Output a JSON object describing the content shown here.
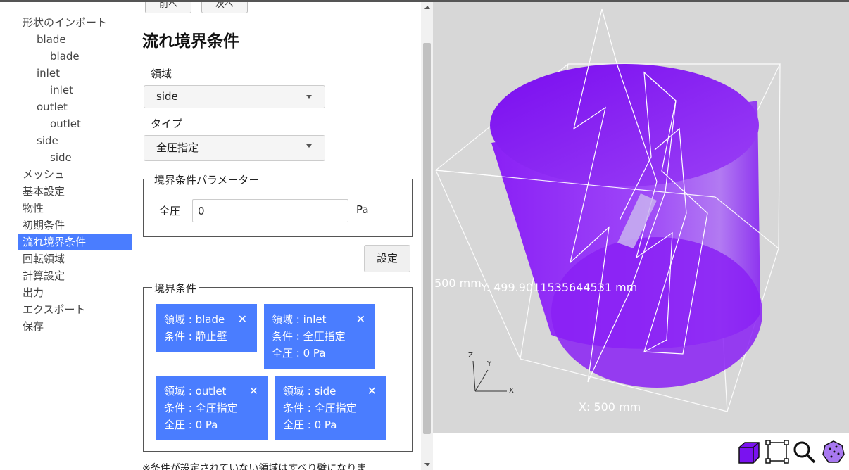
{
  "sidebar": {
    "items": [
      {
        "label": "形状のインポート",
        "level": 0
      },
      {
        "label": "blade",
        "level": 1
      },
      {
        "label": "blade",
        "level": 2
      },
      {
        "label": "inlet",
        "level": 1
      },
      {
        "label": "inlet",
        "level": 2
      },
      {
        "label": "outlet",
        "level": 1
      },
      {
        "label": "outlet",
        "level": 2
      },
      {
        "label": "side",
        "level": 1
      },
      {
        "label": "side",
        "level": 2
      },
      {
        "label": "メッシュ",
        "level": 0
      },
      {
        "label": "基本設定",
        "level": 0
      },
      {
        "label": "物性",
        "level": 0
      },
      {
        "label": "初期条件",
        "level": 0
      },
      {
        "label": "流れ境界条件",
        "level": 0,
        "active": true
      },
      {
        "label": "回転領域",
        "level": 0
      },
      {
        "label": "計算設定",
        "level": 0
      },
      {
        "label": "出力",
        "level": 0
      },
      {
        "label": "エクスポート",
        "level": 0
      },
      {
        "label": "保存",
        "level": 0
      }
    ]
  },
  "panel": {
    "prev_label": "前へ",
    "next_label": "次へ",
    "title": "流れ境界条件",
    "region_label": "領域",
    "region_value": "side",
    "type_label": "タイプ",
    "type_value": "全圧指定",
    "params_legend": "境界条件パラメーター",
    "param_label": "全圧",
    "param_value": "0",
    "param_unit": "Pa",
    "set_button": "設定",
    "conditions_legend": "境界条件",
    "conditions": [
      {
        "region": "領域 : blade",
        "condition": "条件 : 静止壁",
        "pressure": ""
      },
      {
        "region": "領域 : inlet",
        "condition": "条件 : 全圧指定",
        "pressure": "全圧 : 0 Pa"
      },
      {
        "region": "領域 : outlet",
        "condition": "条件 : 全圧指定",
        "pressure": "全圧 : 0 Pa"
      },
      {
        "region": "領域 : side",
        "condition": "条件 : 全圧指定",
        "pressure": "全圧 : 0 Pa"
      }
    ],
    "close_glyph": "✕",
    "note": "※条件が設定されていない領域はすべり壁になりま"
  },
  "viewport": {
    "label_z": "500 mm",
    "label_y": "Y: 499.9011535644531 mm",
    "label_x": "X: 500 mm",
    "axis_x": "X",
    "axis_y": "Y",
    "axis_z": "Z",
    "cylinder_color": "#8a20f5"
  },
  "toolbar": {
    "tools": [
      "solid-view-icon",
      "fit-view-icon",
      "zoom-icon",
      "point-view-icon"
    ]
  },
  "colors": {
    "accent": "#4a7dff",
    "viewport_bg": "#d7d7d7"
  }
}
